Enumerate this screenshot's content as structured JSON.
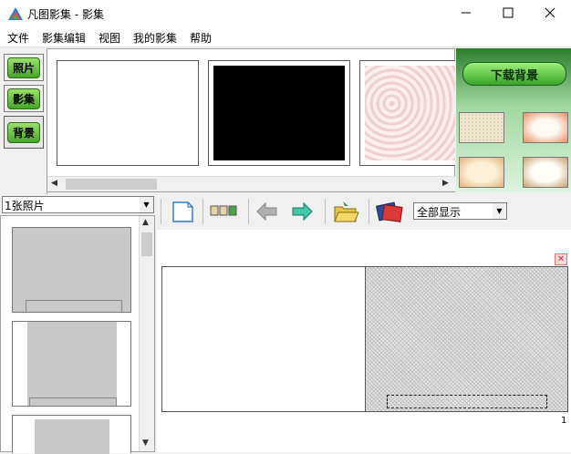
{
  "window": {
    "title": "凡图影集 - 影集"
  },
  "menu": {
    "items": [
      "文件",
      "影集编辑",
      "视图",
      "我的影集",
      "帮助"
    ]
  },
  "tabs": [
    {
      "label": "照片"
    },
    {
      "label": "影集"
    },
    {
      "label": "背景",
      "active": true
    }
  ],
  "backgrounds_panel": {
    "download_label": "下载背景"
  },
  "photo_list": {
    "selected": "1张照片"
  },
  "toolbar": {
    "view_filter": "全部显示"
  },
  "canvas": {
    "page_number": "1"
  },
  "colors": {
    "accent_green": "#46a52b",
    "bg_panel_green": "#2e7d2e",
    "close_red": "#c33333"
  },
  "icons": [
    "app-icon",
    "minimize-icon",
    "maximize-icon",
    "close-icon",
    "new-page-icon",
    "layout-icon",
    "back-arrow-icon",
    "forward-arrow-icon",
    "open-folder-icon",
    "album-icon"
  ]
}
